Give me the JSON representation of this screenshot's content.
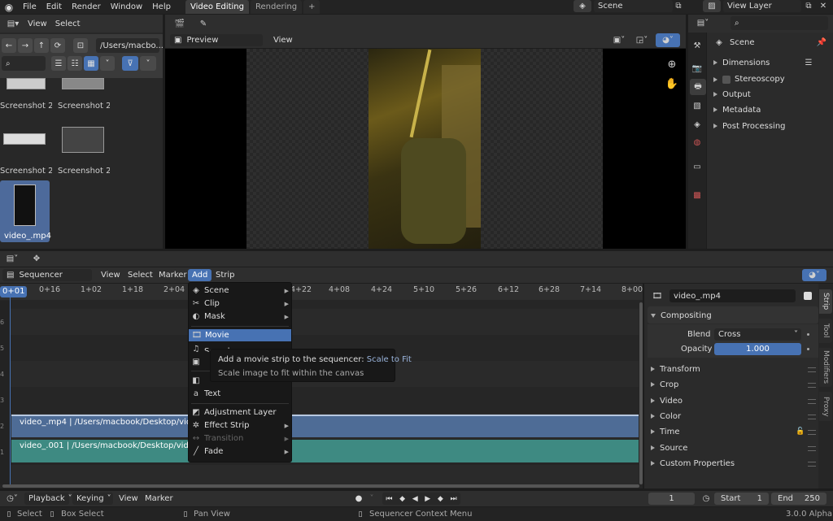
{
  "menubar": {
    "items": [
      "File",
      "Edit",
      "Render",
      "Window",
      "Help"
    ],
    "workspace_tabs": [
      {
        "label": "Video Editing",
        "active": true
      },
      {
        "label": "Rendering",
        "active": false
      }
    ],
    "scene": "Scene",
    "view_layer": "View Layer"
  },
  "file_browser": {
    "view_label": "View",
    "select_label": "Select",
    "path": "/Users/macbo...",
    "files": [
      {
        "name": "Screenshot 2...",
        "selected": false
      },
      {
        "name": "Screenshot 2...",
        "selected": false
      },
      {
        "name": "Screenshot 2...",
        "selected": false
      },
      {
        "name": "Screenshot 2...",
        "selected": false
      },
      {
        "name": "video_.mp4",
        "selected": true
      }
    ]
  },
  "preview": {
    "mode": "Preview",
    "view_label": "View"
  },
  "properties": {
    "title": "Scene",
    "sections": [
      "Dimensions",
      "Stereoscopy",
      "Output",
      "Metadata",
      "Post Processing"
    ]
  },
  "sequencer": {
    "editor": "Sequencer",
    "menus": [
      "View",
      "Select",
      "Marker",
      "Add",
      "Strip"
    ],
    "active_menu": "Add",
    "ruler": [
      "0+01",
      "0+16",
      "1+02",
      "1+18",
      "2+04",
      "3+20",
      "4+06",
      "4+22",
      "4+08",
      "4+24",
      "5+10",
      "5+26",
      "6+12",
      "6+28",
      "7+14",
      "8+00"
    ],
    "strips": [
      {
        "label": "video_.mp4 | /Users/macbook/Desktop/video_.mp4",
        "color": "#4e6c96"
      },
      {
        "label": "video_.001 | /Users/macbook/Desktop/video_.mp4",
        "color": "#3e8a82"
      }
    ],
    "channels": [
      "6",
      "5",
      "4",
      "3",
      "2",
      "1"
    ]
  },
  "add_menu": {
    "items": [
      {
        "label": "Scene",
        "icon": "scene-icon",
        "submenu": true
      },
      {
        "label": "Clip",
        "icon": "clip-icon",
        "submenu": true
      },
      {
        "label": "Mask",
        "icon": "mask-icon",
        "submenu": true
      },
      {
        "label": "Movie",
        "icon": "movie-icon",
        "submenu": false,
        "highlighted": true
      },
      {
        "label": "Sound",
        "icon": "sound-icon",
        "submenu": false
      },
      {
        "label": "Image",
        "icon": "image-icon",
        "submenu": false
      },
      {
        "label": "Color",
        "icon": "color-icon",
        "submenu": false
      },
      {
        "label": "Text",
        "icon": "text-icon",
        "submenu": false
      },
      {
        "label": "Adjustment Layer",
        "icon": "adjustment-icon",
        "submenu": false
      },
      {
        "label": "Effect Strip",
        "icon": "effect-icon",
        "submenu": true
      },
      {
        "label": "Transition",
        "icon": "transition-icon",
        "submenu": true,
        "disabled": true
      },
      {
        "label": "Fade",
        "icon": "fade-icon",
        "submenu": true
      }
    ],
    "tooltip": {
      "line1": "Add a movie strip to the sequencer:",
      "line1_accent": "Scale to Fit",
      "line2": "Scale image to fit within the canvas"
    }
  },
  "strip_props": {
    "name": "video_.mp4",
    "compositing_label": "Compositing",
    "blend_label": "Blend",
    "blend_value": "Cross",
    "opacity_label": "Opacity",
    "opacity_value": "1.000",
    "sections": [
      "Transform",
      "Crop",
      "Video",
      "Color",
      "Time",
      "Source",
      "Custom Properties"
    ],
    "tabs": [
      "Strip",
      "Tool",
      "Modifiers",
      "Proxy"
    ]
  },
  "timeline": {
    "playback": "Playback",
    "keying": "Keying",
    "view": "View",
    "marker": "Marker",
    "current_frame": "1",
    "start_label": "Start",
    "start": "1",
    "end_label": "End",
    "end": "250"
  },
  "statusbar": {
    "select": "Select",
    "box_select": "Box Select",
    "pan_view": "Pan View",
    "context_menu": "Sequencer Context Menu",
    "version": "3.0.0 Alpha"
  }
}
